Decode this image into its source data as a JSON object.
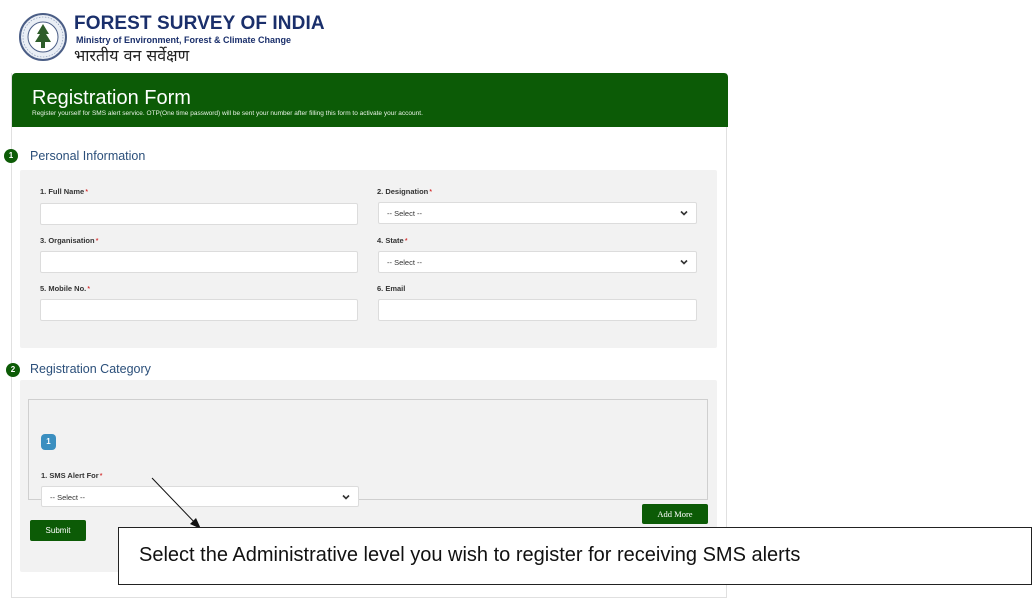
{
  "header": {
    "title": "FOREST SURVEY OF INDIA",
    "subtitle": "Ministry of Environment, Forest & Climate Change",
    "hindi_title": "भारतीय वन सर्वेक्षण",
    "logo_icon": "fsi-emblem-icon"
  },
  "form": {
    "title": "Registration Form",
    "description": "Register yourself for SMS alert service. OTP(One time password) will be sent your number after filling this form to activate your account.",
    "accent_color": "#0c5b06"
  },
  "personal": {
    "step": "1",
    "title": "Personal Information",
    "fields": {
      "full_name": {
        "label": "1. Full Name",
        "required": "*",
        "value": ""
      },
      "designation": {
        "label": "2. Designation",
        "required": "*",
        "selected": "-- Select --"
      },
      "organisation": {
        "label": "3. Organisation",
        "required": "*",
        "value": ""
      },
      "state": {
        "label": "4. State",
        "required": "*",
        "selected": "-- Select --"
      },
      "mobile": {
        "label": "5. Mobile No.",
        "required": "*",
        "value": ""
      },
      "email": {
        "label": "6. Email",
        "value": ""
      }
    }
  },
  "category": {
    "step": "2",
    "title": "Registration Category",
    "entry_number": "1",
    "sms_alert": {
      "label": "1. SMS Alert For",
      "required": "*",
      "selected": "-- Select --"
    },
    "add_more_label": "Add More",
    "submit_label": "Submit"
  },
  "annotation": {
    "text": "Select the Administrative level you wish to register for receiving SMS alerts"
  }
}
